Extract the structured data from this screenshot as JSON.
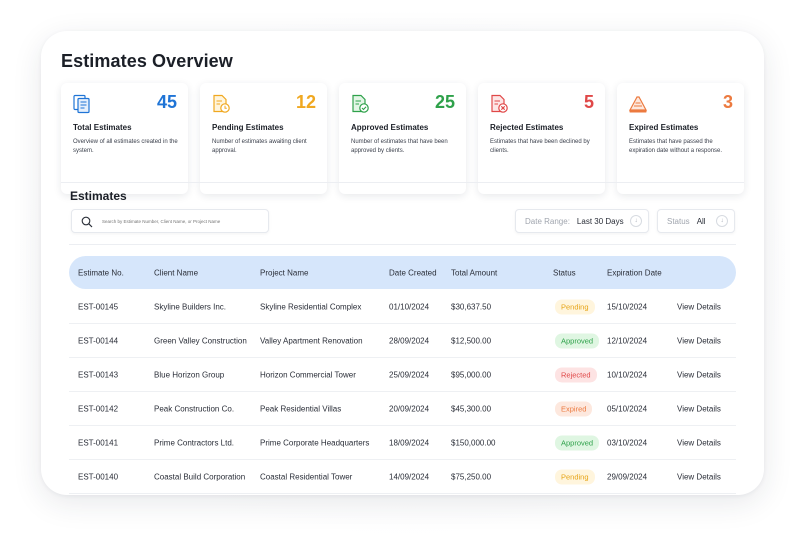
{
  "page": {
    "title": "Estimates Overview"
  },
  "stats": [
    {
      "count": "45",
      "label": "Total Estimates",
      "desc": "Overview of all estimates created in the system.",
      "color": "#1f74d6",
      "icon": "document-stack-icon"
    },
    {
      "count": "12",
      "label": "Pending Estimates",
      "desc": "Number of estimates awaiting client approval.",
      "color": "#f0a820",
      "icon": "clock-document-icon"
    },
    {
      "count": "25",
      "label": "Approved Estimates",
      "desc": "Number of estimates that have been approved by clients.",
      "color": "#2ea14a",
      "icon": "check-document-icon"
    },
    {
      "count": "5",
      "label": "Rejected Estimates",
      "desc": "Estimates that have been declined by clients.",
      "color": "#e04848",
      "icon": "x-document-icon"
    },
    {
      "count": "3",
      "label": "Expired Estimates",
      "desc": "Estimates that have passed the expiration date without a response.",
      "color": "#ec7a3f",
      "icon": "expired-document-icon"
    }
  ],
  "estimates": {
    "title": "Estimates",
    "search_placeholder": "Search by Estimate Number, Client Name, or Project Name",
    "date_range": {
      "label": "Date Range:",
      "value": "Last 30 Days"
    },
    "status_filter": {
      "label": "Status",
      "value": "All"
    },
    "columns": [
      "Estimate No.",
      "Client Name",
      "Project Name",
      "Date Created",
      "Total Amount",
      "Status",
      "Expiration Date"
    ],
    "rows": [
      {
        "no": "EST-00145",
        "client": "Skyline Builders Inc.",
        "project": "Skyline Residential Complex",
        "date": "01/10/2024",
        "amount": "$30,637.50",
        "status": "Pending",
        "expires": "15/10/2024",
        "action": "View Details"
      },
      {
        "no": "EST-00144",
        "client": "Green Valley Construction",
        "project": "Valley Apartment Renovation",
        "date": "28/09/2024",
        "amount": "$12,500.00",
        "status": "Approved",
        "expires": "12/10/2024",
        "action": "View Details"
      },
      {
        "no": "EST-00143",
        "client": "Blue Horizon Group",
        "project": "Horizon Commercial Tower",
        "date": "25/09/2024",
        "amount": "$95,000.00",
        "status": "Rejected",
        "expires": "10/10/2024",
        "action": "View Details"
      },
      {
        "no": "EST-00142",
        "client": "Peak Construction Co.",
        "project": "Peak Residential Villas",
        "date": "20/09/2024",
        "amount": "$45,300.00",
        "status": "Expired",
        "expires": "05/10/2024",
        "action": "View Details"
      },
      {
        "no": "EST-00141",
        "client": "Prime Contractors Ltd.",
        "project": "Prime Corporate Headquarters",
        "date": "18/09/2024",
        "amount": "$150,000.00",
        "status": "Approved",
        "expires": "03/10/2024",
        "action": "View Details"
      },
      {
        "no": "EST-00140",
        "client": "Coastal Build Corporation",
        "project": "Coastal Residential Tower",
        "date": "14/09/2024",
        "amount": "$75,250.00",
        "status": "Pending",
        "expires": "29/09/2024",
        "action": "View Details"
      }
    ]
  }
}
